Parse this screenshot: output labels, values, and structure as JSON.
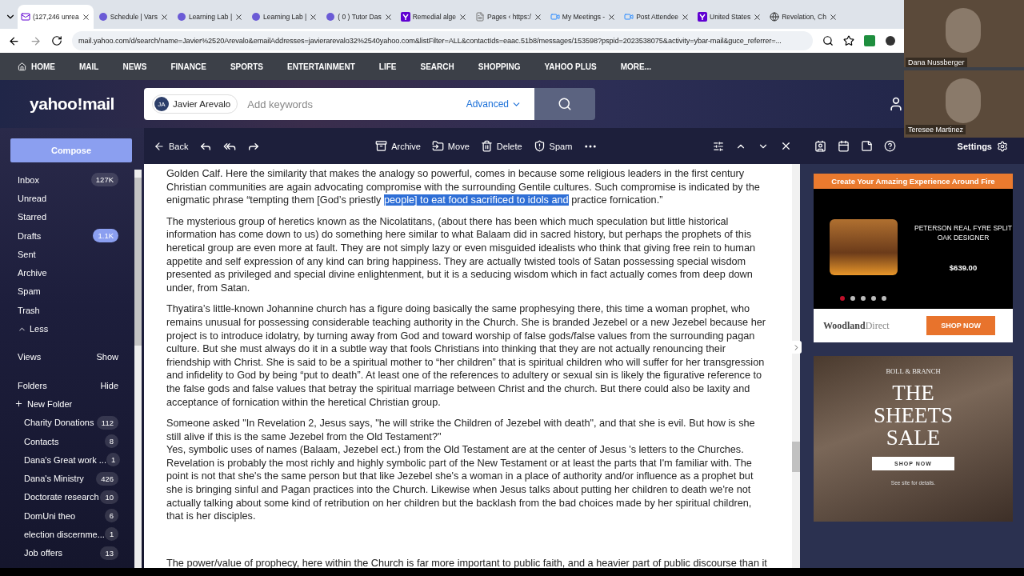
{
  "browser": {
    "tabs": [
      {
        "label": "(127,246 unrea",
        "kind": "mail",
        "selected": true
      },
      {
        "label": "Schedule | Vars",
        "kind": "lab",
        "selected": false
      },
      {
        "label": "Learning Lab |",
        "kind": "lab",
        "selected": false
      },
      {
        "label": "Learning Lab |",
        "kind": "lab",
        "selected": false
      },
      {
        "label": "( 0 ) Tutor Das",
        "kind": "lab",
        "selected": false
      },
      {
        "label": "Remedial alge",
        "kind": "yahoo",
        "selected": false
      },
      {
        "label": "Pages ‹ https:/",
        "kind": "pages",
        "selected": false
      },
      {
        "label": "My Meetings -",
        "kind": "zoom",
        "selected": false
      },
      {
        "label": "Post Attendee",
        "kind": "zoom",
        "selected": false
      },
      {
        "label": "United States",
        "kind": "yahoo",
        "selected": false
      },
      {
        "label": "Revelation, Ch",
        "kind": "globe",
        "selected": false
      }
    ],
    "url": "mail.yahoo.com/d/search/name=Javier%2520Arevalo&emailAddresses=javierarevalo32%2540yahoo.com&listFilter=ALL&contactIds=eaac.51b8/messages/153598?pspid=2023538075&activity=ybar-mail&guce_referrer=..."
  },
  "nav": [
    "HOME",
    "MAIL",
    "NEWS",
    "FINANCE",
    "SPORTS",
    "ENTERTAINMENT",
    "LIFE",
    "SEARCH",
    "SHOPPING",
    "YAHOO PLUS",
    "MORE..."
  ],
  "header": {
    "logo": "yahoo!mail",
    "chip_initials": "JA",
    "chip_name": "Javier Arevalo",
    "placeholder": "Add keywords",
    "advanced": "Advanced"
  },
  "sidebar": {
    "compose": "Compose",
    "items": [
      {
        "label": "Inbox",
        "count": "127K",
        "highlight": false
      },
      {
        "label": "Unread"
      },
      {
        "label": "Starred"
      },
      {
        "label": "Drafts",
        "count": "1.1K",
        "highlight": true
      },
      {
        "label": "Sent"
      },
      {
        "label": "Archive"
      },
      {
        "label": "Spam"
      },
      {
        "label": "Trash"
      }
    ],
    "less": "Less",
    "views": "Views",
    "views_action": "Show",
    "folders": "Folders",
    "folders_action": "Hide",
    "new_folder": "New Folder",
    "folders_list": [
      {
        "label": "Charity Donations",
        "count": "112"
      },
      {
        "label": "Contacts",
        "count": "8"
      },
      {
        "label": "Dana's Great work ...",
        "count": "1"
      },
      {
        "label": "Dana's Ministry",
        "count": "426"
      },
      {
        "label": "Doctorate research",
        "count": "10"
      },
      {
        "label": "DomUni theo",
        "count": "6"
      },
      {
        "label": "election discernme...",
        "count": "1"
      },
      {
        "label": "Job offers",
        "count": "13"
      }
    ]
  },
  "toolbar": {
    "back": "Back",
    "actions": [
      "Archive",
      "Move",
      "Delete",
      "Spam"
    ],
    "settings": "Settings"
  },
  "message": {
    "paragraphs": [
      {
        "kind": "paragraph",
        "segments": [
          {
            "text": "Golden Calf. Here the similarity that makes the analogy so powerful, comes in because some religious leaders in the first century Christian communities are again advocating compromise with the surrounding Gentile cultures. Such compromise is indicated by the enigmatic phrase “tempting them [God’s priestly ",
            "selected": false
          },
          {
            "text": "people] to eat food sacrificed to idols and",
            "selected": true
          },
          {
            "text": " practice fornication.”",
            "selected": false
          }
        ]
      },
      {
        "kind": "paragraph",
        "segments": [
          {
            "text": "The mysterious group of heretics known as the Nicolatitans, (about there has been which much speculation but little historical information has come down to us) do something here similar to what Balaam did in sacred history, but perhaps the prophets of this heretical group are even more at fault. They are not simply lazy or even misguided idealists who think that giving free rein to human appetite and self expression of any kind can bring happiness. They are actually twisted tools of Satan possessing special wisdom presented as privileged and special divine enlightenment, but it is a seducing wisdom which in fact actually comes from deep down under, from Satan.",
            "selected": false
          }
        ]
      },
      {
        "kind": "paragraph",
        "segments": [
          {
            "text": "Thyatira’s little-known Johannine church has a figure doing basically the same prophesying there, this time a woman prophet, who remains unusual for possessing considerable teaching authority in the Church. She is branded Jezebel or a new Jezebel because her project is to introduce idolatry, by turning away from God and toward worship of false gods/false values from the surrounding pagan culture. But she must always do it in a subtle way that fools Christians into thinking that they are not actually renouncing their friendship with Christ. She is said to be a spiritual mother to “her children” that is spiritual children who will suffer for her transgression and infidelity to God by being “put to death”. At least one of the references to adultery or sexual sin is likely the figurative reference to the false gods and false values that betray the spiritual marriage between Christ and the church. But there could also be laxity and acceptance of fornication within the heretical Christian group.",
            "selected": false
          }
        ]
      },
      {
        "kind": "paragraph",
        "segments": [
          {
            "text": "Someone asked \"In Revelation 2, Jesus says, \"he will strike the Children of Jezebel with death\", and that she is evil. But how is she still alive if this is the same Jezebel from the Old Testament?\"",
            "selected": false
          }
        ]
      },
      {
        "kind": "continuation",
        "segments": [
          {
            "text": "Yes, symbolic uses of names (Balaam, Jezebel ect.) from the Old Testament are at the center of Jesus 's letters to the Churches. Revelation is probably the most richly and highly symbolic part of the New Testament or at least the parts that I'm familiar with. The point is not that she's the same person but that like Jezebel she's a woman in a place of authority and/or influence as a prophet but she is bringing sinful and Pagan practices into the Church. Likewise when Jesus talks about putting her children to death we're not actually talking about some kind of retribution on her children but the backlash from the bad choices made by her spiritual children, that is her disciples.",
            "selected": false
          }
        ]
      },
      {
        "kind": "spaced",
        "segments": [
          {
            "text": "The power/value of prophecy, here within the Church is far more important to public faith, and a heavier part of public discourse than it",
            "selected": false
          }
        ]
      }
    ]
  },
  "ads": [
    {
      "kind": "product",
      "headline": "Create Your Amazing Experience Around Fire",
      "product": "PETERSON REAL FYRE SPLIT OAK DESIGNER",
      "price": "$639.00",
      "dots": [
        {
          "selected": true
        },
        {
          "selected": false
        },
        {
          "selected": false
        },
        {
          "selected": false
        },
        {
          "selected": false
        }
      ],
      "brand_main": "Woodland",
      "brand_rest": "Direct",
      "cta": "SHOP NOW"
    },
    {
      "kind": "banner",
      "brand": "BOLL & BRANCH",
      "title": [
        "THE",
        "SHEETS",
        "SALE"
      ],
      "cta": "SHOP NOW",
      "note": "See site for details."
    }
  ],
  "call": [
    {
      "name": "Dana Nussberger"
    },
    {
      "name": "Teresee Martinez"
    }
  ]
}
